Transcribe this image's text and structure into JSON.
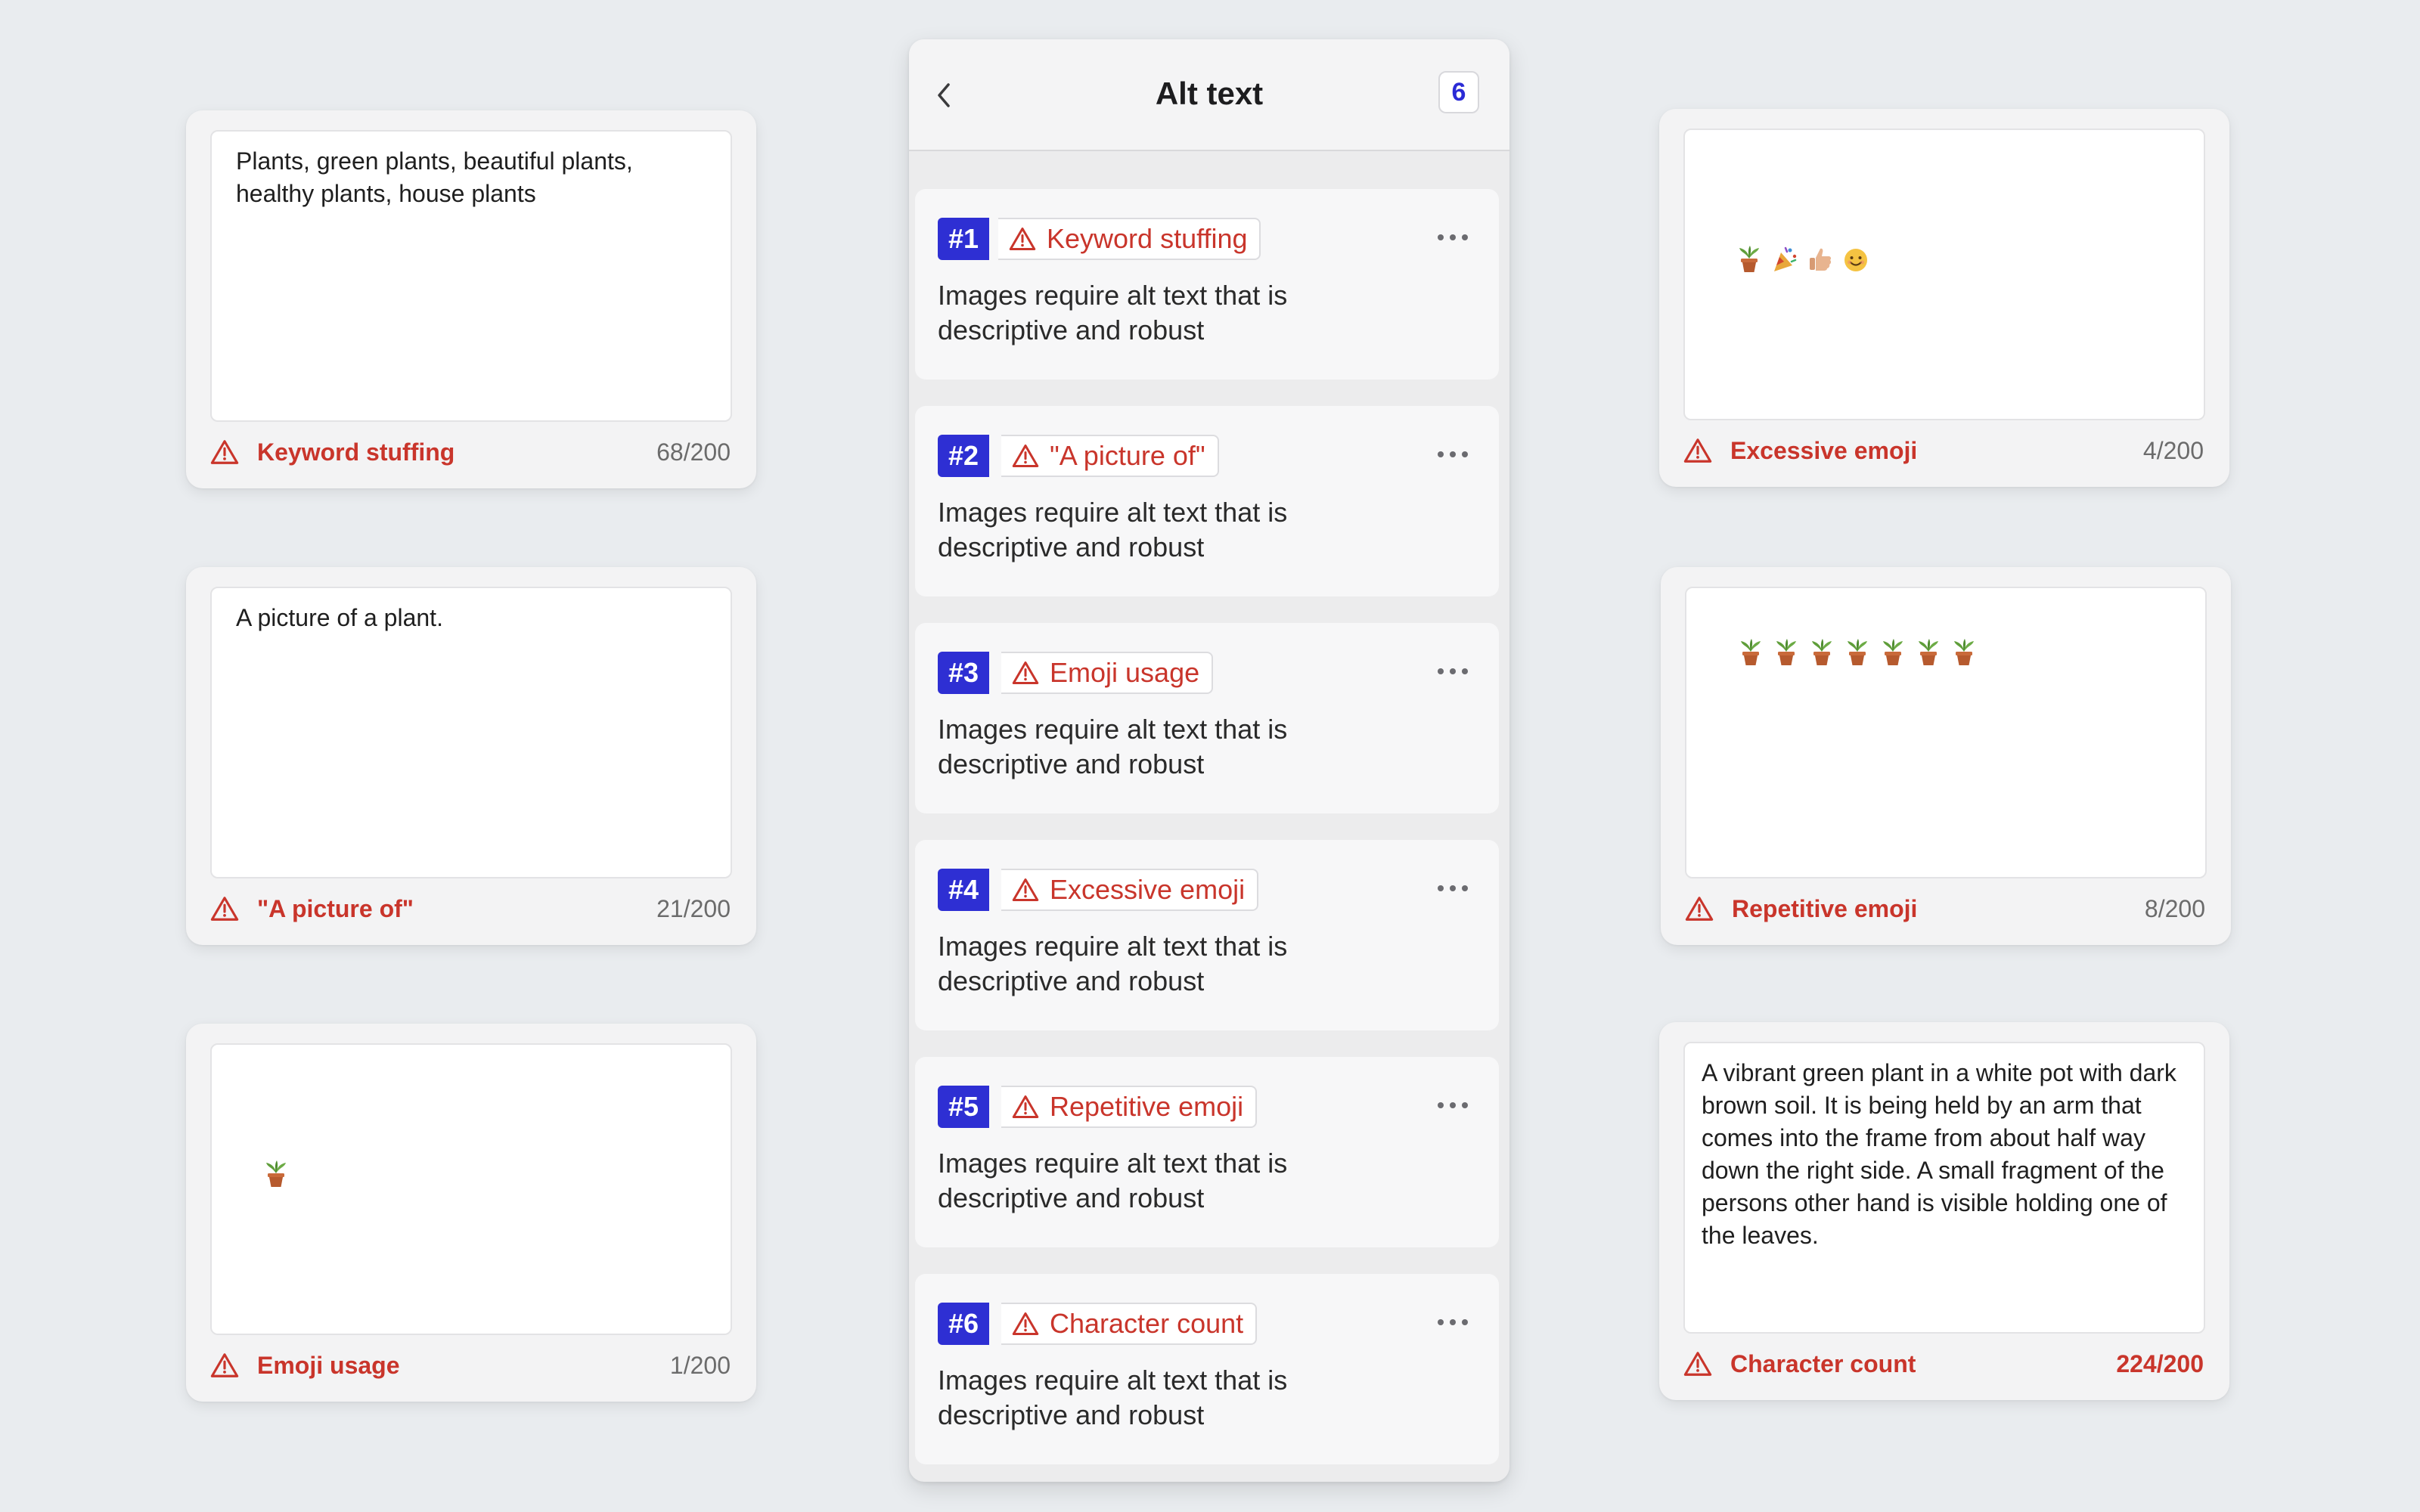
{
  "panel": {
    "title": "Alt text",
    "issue_count": "6",
    "issues": [
      {
        "number": "#1",
        "label": "Keyword stuffing",
        "description": "Images require alt text that is descriptive and robust"
      },
      {
        "number": "#2",
        "label": "\"A picture of\"",
        "description": "Images require alt text that is descriptive and robust"
      },
      {
        "number": "#3",
        "label": "Emoji usage",
        "description": "Images require alt text that is descriptive and robust"
      },
      {
        "number": "#4",
        "label": "Excessive emoji",
        "description": "Images require alt text that is descriptive and robust"
      },
      {
        "number": "#5",
        "label": "Repetitive emoji",
        "description": "Images require alt text that is descriptive and robust"
      },
      {
        "number": "#6",
        "label": "Character count",
        "description": "Images require alt text that is descriptive and robust"
      }
    ]
  },
  "cards": {
    "keyword": {
      "text": "Plants, green plants, beautiful plants,\nhealthy plants, house plants",
      "warning": "Keyword stuffing",
      "count": "68/200"
    },
    "picture_of": {
      "text": "A picture of a plant.",
      "warning": "\"A picture of\"",
      "count": "21/200"
    },
    "emoji_usage": {
      "emojis": [
        "potted-plant"
      ],
      "warning": "Emoji usage",
      "count": "1/200"
    },
    "excessive": {
      "emojis": [
        "potted-plant",
        "party-popper",
        "thumbs-up",
        "smiling-face"
      ],
      "warning": "Excessive emoji",
      "count": "4/200"
    },
    "repetitive": {
      "emojis": [
        "potted-plant",
        "potted-plant",
        "potted-plant",
        "potted-plant",
        "potted-plant",
        "potted-plant",
        "potted-plant"
      ],
      "warning": "Repetitive emoji",
      "count": "8/200"
    },
    "character": {
      "text": "A vibrant green plant in a white pot with dark brown soil. It is being held by an arm that comes into the frame from about half way down the right side. A small fragment of the persons other hand is visible holding one of the leaves.",
      "warning": "Character count",
      "count": "224/200"
    }
  },
  "colors": {
    "background": "#e9ecef",
    "warning": "#c9352b",
    "accent": "#2e2fd3"
  }
}
